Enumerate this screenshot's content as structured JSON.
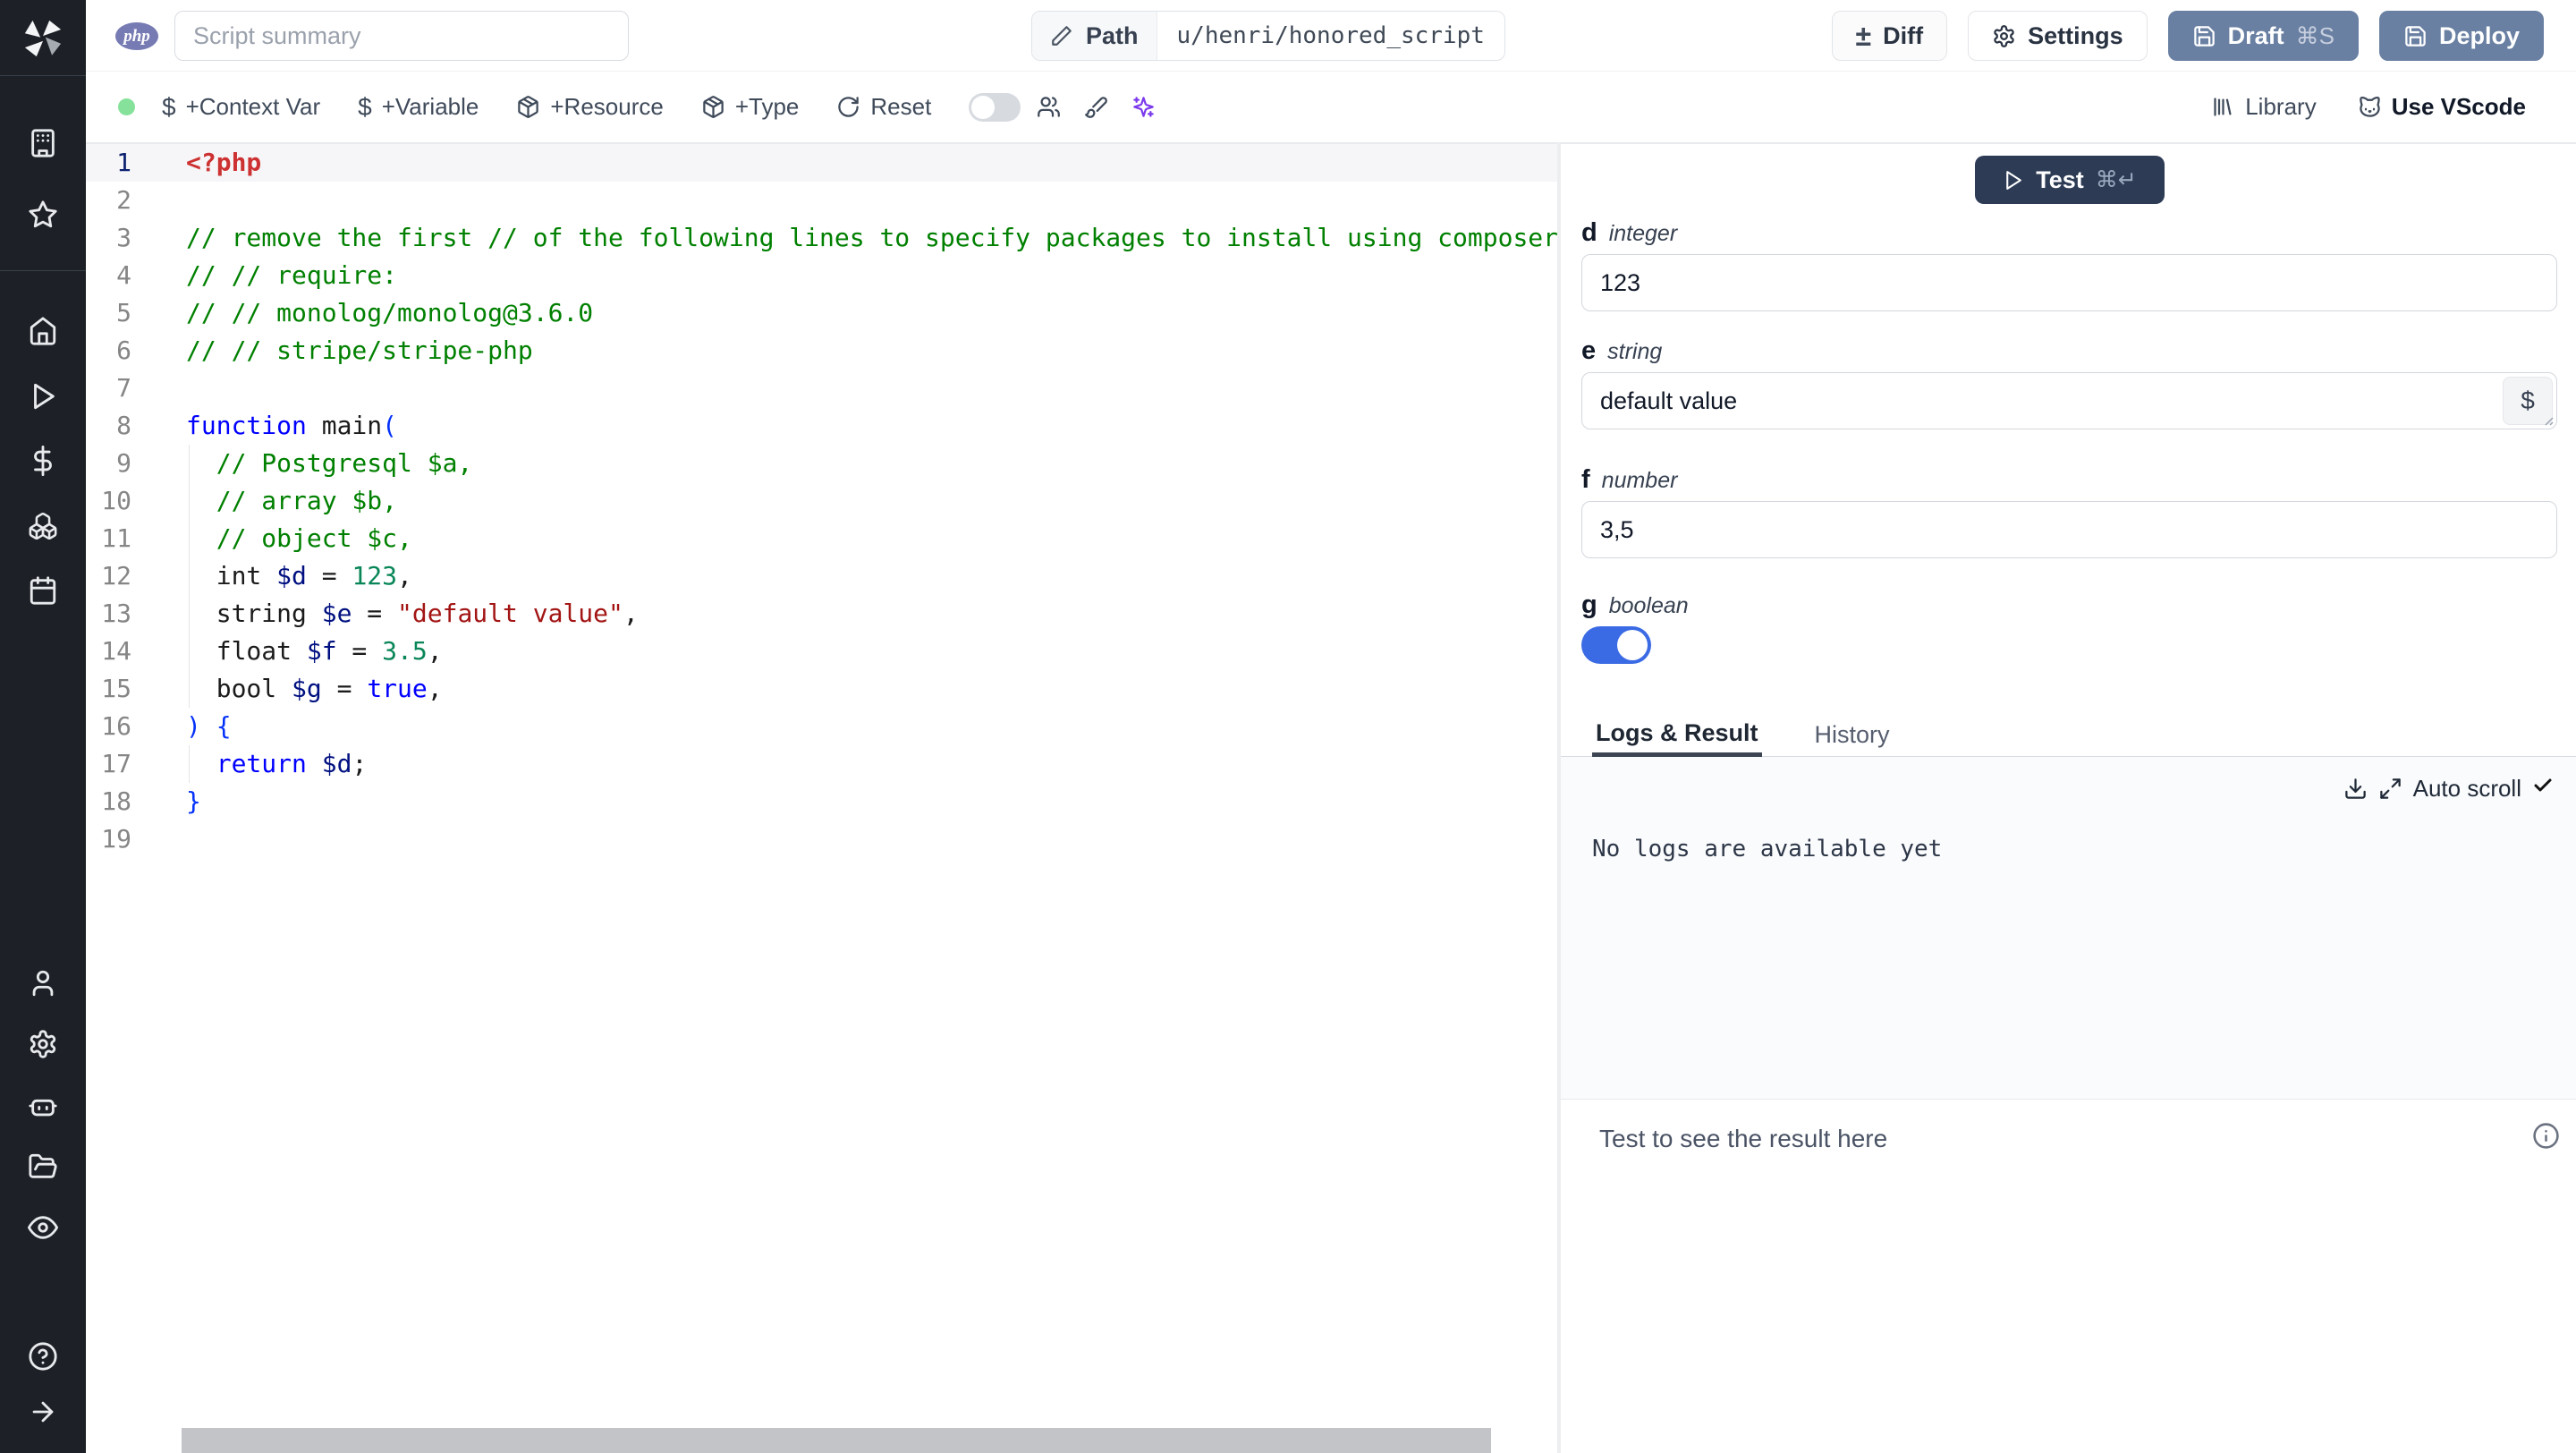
{
  "app": {
    "title": "Windmill script editor"
  },
  "colors": {
    "sidebar_bg": "#1d2127",
    "primary_button": "#6980a3",
    "test_button": "#2d3b55",
    "toggle_on": "#3b6be4",
    "status_dot": "#86e29b",
    "ai_accent": "#7c3aed",
    "php_badge": "#777bb3"
  },
  "glyphs": {
    "dollar": "$",
    "plus_minus": "±"
  },
  "topbar": {
    "language_badge": "php",
    "summary_placeholder": "Script summary",
    "path": {
      "label": "Path",
      "value": "u/henri/honored_script"
    },
    "diff_label": "Diff",
    "settings_label": "Settings",
    "draft_label": "Draft",
    "draft_shortcut": "⌘S",
    "deploy_label": "Deploy"
  },
  "toolbar": {
    "context_var_label": "+Context Var",
    "variable_label": "+Variable",
    "resource_label": "+Resource",
    "type_label": "+Type",
    "reset_label": "Reset",
    "library_label": "Library",
    "vscode_label": "Use VScode"
  },
  "editor": {
    "language": "php",
    "lines": [
      {
        "n": 1,
        "active": true,
        "guide": false,
        "segs": [
          [
            "tag",
            "<?php"
          ]
        ]
      },
      {
        "n": 2,
        "active": false,
        "guide": false,
        "segs": []
      },
      {
        "n": 3,
        "active": false,
        "guide": false,
        "segs": [
          [
            "comment",
            "// remove the first // of the following lines to specify packages to install using composer"
          ]
        ]
      },
      {
        "n": 4,
        "active": false,
        "guide": false,
        "segs": [
          [
            "comment",
            "// // require:"
          ]
        ]
      },
      {
        "n": 5,
        "active": false,
        "guide": false,
        "segs": [
          [
            "comment",
            "// // monolog/monolog@3.6.0"
          ]
        ]
      },
      {
        "n": 6,
        "active": false,
        "guide": false,
        "segs": [
          [
            "comment",
            "// // stripe/stripe-php"
          ]
        ]
      },
      {
        "n": 7,
        "active": false,
        "guide": false,
        "segs": []
      },
      {
        "n": 8,
        "active": false,
        "guide": false,
        "segs": [
          [
            "keyword",
            "function "
          ],
          [
            "plain",
            "main"
          ],
          [
            "bracket",
            "("
          ]
        ]
      },
      {
        "n": 9,
        "active": false,
        "guide": true,
        "segs": [
          [
            "comment",
            "  // Postgresql $a,"
          ]
        ]
      },
      {
        "n": 10,
        "active": false,
        "guide": true,
        "segs": [
          [
            "comment",
            "  // array $b,"
          ]
        ]
      },
      {
        "n": 11,
        "active": false,
        "guide": true,
        "segs": [
          [
            "comment",
            "  // object $c,"
          ]
        ]
      },
      {
        "n": 12,
        "active": false,
        "guide": true,
        "segs": [
          [
            "plain",
            "  int "
          ],
          [
            "variable",
            "$d"
          ],
          [
            "plain",
            " = "
          ],
          [
            "number",
            "123"
          ],
          [
            "plain",
            ","
          ]
        ]
      },
      {
        "n": 13,
        "active": false,
        "guide": true,
        "segs": [
          [
            "plain",
            "  string "
          ],
          [
            "variable",
            "$e"
          ],
          [
            "plain",
            " = "
          ],
          [
            "string",
            "\"default value\""
          ],
          [
            "plain",
            ","
          ]
        ]
      },
      {
        "n": 14,
        "active": false,
        "guide": true,
        "segs": [
          [
            "plain",
            "  float "
          ],
          [
            "variable",
            "$f"
          ],
          [
            "plain",
            " = "
          ],
          [
            "number",
            "3.5"
          ],
          [
            "plain",
            ","
          ]
        ]
      },
      {
        "n": 15,
        "active": false,
        "guide": true,
        "segs": [
          [
            "plain",
            "  bool "
          ],
          [
            "variable",
            "$g"
          ],
          [
            "plain",
            " = "
          ],
          [
            "keyword",
            "true"
          ],
          [
            "plain",
            ","
          ]
        ]
      },
      {
        "n": 16,
        "active": false,
        "guide": false,
        "segs": [
          [
            "bracket",
            ") {"
          ]
        ]
      },
      {
        "n": 17,
        "active": false,
        "guide": true,
        "segs": [
          [
            "plain",
            "  "
          ],
          [
            "keyword",
            "return "
          ],
          [
            "variable",
            "$d"
          ],
          [
            "plain",
            ";"
          ]
        ]
      },
      {
        "n": 18,
        "active": false,
        "guide": false,
        "segs": [
          [
            "bracket",
            "}"
          ]
        ]
      },
      {
        "n": 19,
        "active": false,
        "guide": false,
        "segs": []
      }
    ]
  },
  "form": {
    "test_label": "Test",
    "test_shortcut": "⌘↵",
    "fields": {
      "d": {
        "name": "d",
        "type": "integer",
        "value": "123"
      },
      "e": {
        "name": "e",
        "type": "string",
        "value": "default value",
        "picker": "$"
      },
      "f": {
        "name": "f",
        "type": "number",
        "value": "3,5"
      },
      "g": {
        "name": "g",
        "type": "boolean",
        "value": "on"
      }
    }
  },
  "results": {
    "tab_logs": "Logs & Result",
    "tab_history": "History",
    "auto_scroll_label": "Auto scroll",
    "no_logs_text": "No logs are available yet",
    "result_placeholder": "Test to see the result here"
  },
  "icons": [
    "windmill-logo",
    "building",
    "star",
    "home",
    "play",
    "dollar-sign",
    "boxes",
    "calendar",
    "user",
    "gear",
    "robot",
    "folder-open",
    "eye",
    "help-circle",
    "arrow-right",
    "pencil",
    "plus-minus",
    "gear",
    "save",
    "package",
    "refresh",
    "users",
    "brush",
    "sparkles",
    "library-bars",
    "vscode-cat",
    "play-outline",
    "download",
    "expand",
    "check",
    "info-circle"
  ]
}
